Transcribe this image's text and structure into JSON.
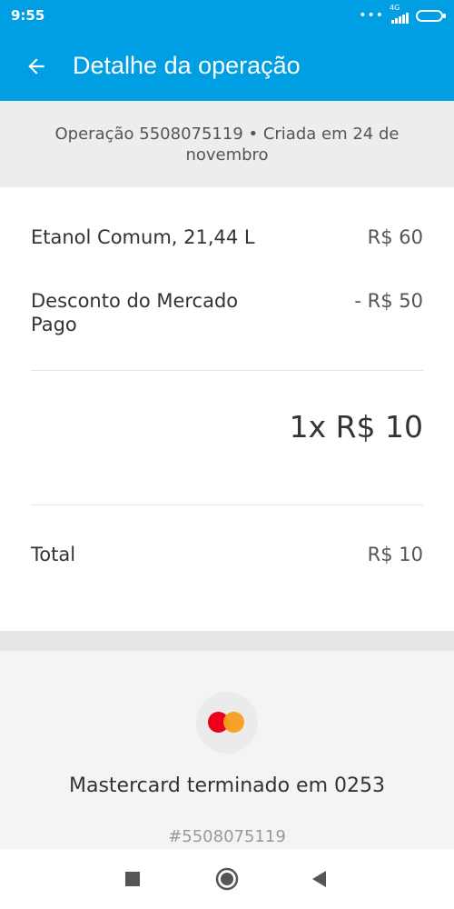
{
  "status_bar": {
    "time": "9:55",
    "network_label": "4G",
    "icons": [
      "more-dots-icon",
      "signal-icon",
      "battery-icon"
    ]
  },
  "app_bar": {
    "title": "Detalhe da operação",
    "back_icon": "arrow-left-icon"
  },
  "operation": {
    "info": "Operação 5508075119 • Criada em 24 de novembro"
  },
  "items": [
    {
      "label": "Etanol Comum, 21,44 L",
      "amount": "R$ 60"
    },
    {
      "label": "Desconto do Mercado Pago",
      "amount": "- R$ 50"
    }
  ],
  "quantity_total": "1x R$ 10",
  "total": {
    "label": "Total",
    "amount": "R$ 10"
  },
  "payment": {
    "card_label": "Mastercard terminado em 0253",
    "operation_number": "#5508075119",
    "brand_icon": "mastercard-icon"
  },
  "colors": {
    "brand_blue": "#009ee3",
    "mastercard_red": "#eb001b",
    "mastercard_orange": "#f79e1b"
  },
  "nav_bar": {
    "icons": [
      "recents-square-icon",
      "home-circle-icon",
      "back-triangle-icon"
    ]
  }
}
